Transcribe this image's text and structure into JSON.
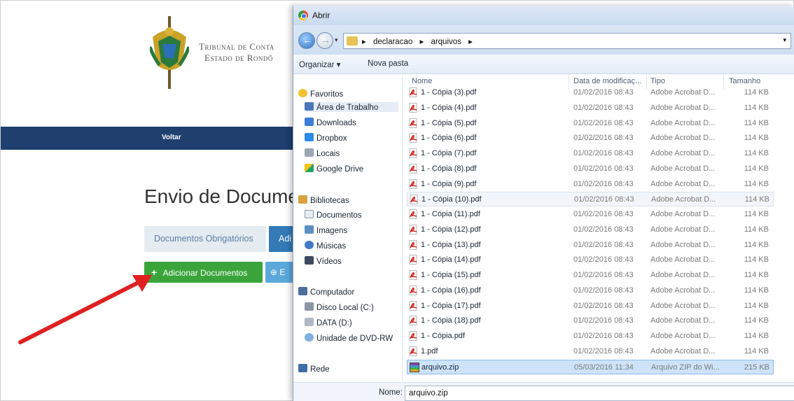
{
  "web": {
    "org_line1": "Tribunal de Conta",
    "org_line2": "Estado de Rondô",
    "nav_back": "Voltar",
    "page_title": "Envio de Docume",
    "tabs": [
      "Documentos Obrigatórios",
      "Adi"
    ],
    "add_button": "Adicionar Documentos",
    "send_button": "E"
  },
  "dialog": {
    "title": "Abrir",
    "path": [
      "declaracao",
      "arquivos"
    ],
    "toolbar": {
      "organize": "Organizar ▾",
      "new_folder": "Nova pasta"
    },
    "nav": {
      "favorites_header": "Favoritos",
      "favorites": [
        "Área de Trabalho",
        "Downloads",
        "Dropbox",
        "Locais",
        "Google Drive"
      ],
      "libraries_header": "Bibliotecas",
      "libraries": [
        "Documentos",
        "Imagens",
        "Músicas",
        "Vídeos"
      ],
      "computer_header": "Computador",
      "drives": [
        "Disco Local (C:)",
        "DATA (D:)",
        "Unidade de DVD-RW"
      ],
      "network_header": "Rede"
    },
    "columns": [
      "Nome",
      "Data de modificaç...",
      "Tipo",
      "Tamanho"
    ],
    "files": [
      {
        "name": "1 - Cópia (3).pdf",
        "date": "01/02/2016 08:43",
        "type": "Adobe Acrobat D...",
        "size": "114 KB"
      },
      {
        "name": "1 - Cópia (4).pdf",
        "date": "01/02/2016 08:43",
        "type": "Adobe Acrobat D...",
        "size": "114 KB"
      },
      {
        "name": "1 - Cópia (5).pdf",
        "date": "01/02/2016 08:43",
        "type": "Adobe Acrobat D...",
        "size": "114 KB"
      },
      {
        "name": "1 - Cópia (6).pdf",
        "date": "01/02/2016 08:43",
        "type": "Adobe Acrobat D...",
        "size": "114 KB"
      },
      {
        "name": "1 - Cópia (7).pdf",
        "date": "01/02/2016 08:43",
        "type": "Adobe Acrobat D...",
        "size": "114 KB"
      },
      {
        "name": "1 - Cópia (8).pdf",
        "date": "01/02/2016 08:43",
        "type": "Adobe Acrobat D...",
        "size": "114 KB"
      },
      {
        "name": "1 - Cópia (9).pdf",
        "date": "01/02/2016 08:43",
        "type": "Adobe Acrobat D...",
        "size": "114 KB"
      },
      {
        "name": "1 - Cópia (10).pdf",
        "date": "01/02/2016 08:43",
        "type": "Adobe Acrobat D...",
        "size": "114 KB"
      },
      {
        "name": "1 - Cópia (11).pdf",
        "date": "01/02/2016 08:43",
        "type": "Adobe Acrobat D...",
        "size": "114 KB"
      },
      {
        "name": "1 - Cópia (12).pdf",
        "date": "01/02/2016 08:43",
        "type": "Adobe Acrobat D...",
        "size": "114 KB"
      },
      {
        "name": "1 - Cópia (13).pdf",
        "date": "01/02/2016 08:43",
        "type": "Adobe Acrobat D...",
        "size": "114 KB"
      },
      {
        "name": "1 - Cópia (14).pdf",
        "date": "01/02/2016 08:43",
        "type": "Adobe Acrobat D...",
        "size": "114 KB"
      },
      {
        "name": "1 - Cópia (15).pdf",
        "date": "01/02/2016 08:43",
        "type": "Adobe Acrobat D...",
        "size": "114 KB"
      },
      {
        "name": "1 - Cópia (16).pdf",
        "date": "01/02/2016 08:43",
        "type": "Adobe Acrobat D...",
        "size": "114 KB"
      },
      {
        "name": "1 - Cópia (17).pdf",
        "date": "01/02/2016 08:43",
        "type": "Adobe Acrobat D...",
        "size": "114 KB"
      },
      {
        "name": "1 - Cópia (18).pdf",
        "date": "01/02/2016 08:43",
        "type": "Adobe Acrobat D...",
        "size": "114 KB"
      },
      {
        "name": "1 - Cópia.pdf",
        "date": "01/02/2016 08:43",
        "type": "Adobe Acrobat D...",
        "size": "114 KB"
      },
      {
        "name": "1.pdf",
        "date": "01/02/2016 08:43",
        "type": "Adobe Acrobat D...",
        "size": "114 KB"
      },
      {
        "name": "arquivo.zip",
        "date": "05/03/2016 11:34",
        "type": "Arquivo ZIP do Wi...",
        "size": "215 KB"
      }
    ],
    "filename_label": "Nome:",
    "filename_value": "arquivo.zip"
  },
  "colors": {
    "navbar": "#1f3f6e",
    "add_button": "#3aa43a",
    "tab_active": "#337ab7",
    "arrow": "#e02020",
    "selection": "#cde3f9"
  }
}
